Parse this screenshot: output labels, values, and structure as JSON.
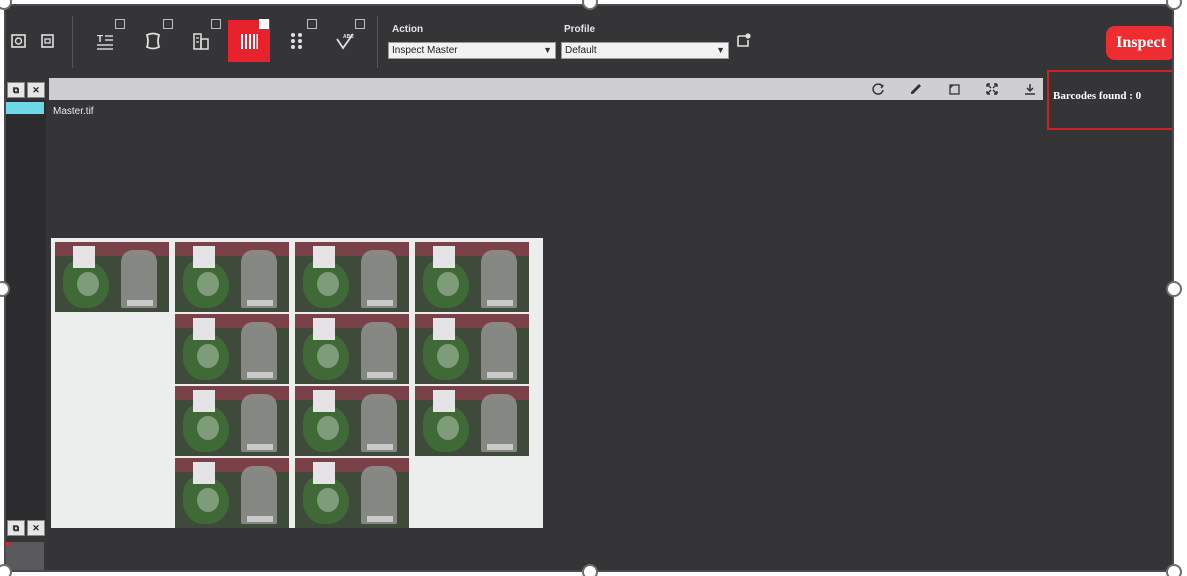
{
  "toolbar": {
    "action_label": "Action",
    "action_value": "Inspect Master",
    "profile_label": "Profile",
    "profile_value": "Default",
    "inspect_label": "Inspect"
  },
  "viewer": {
    "file_name": "Master.tif"
  },
  "results": {
    "barcodes_found": "Barcodes found : 0"
  },
  "mini_panel": {
    "restore_glyph": "⧉",
    "close_glyph": "✕"
  },
  "colors": {
    "accent": "#e8222d",
    "inspect_button": "#ed2d2f",
    "highlight_box": "#d01f25",
    "thumbnail_strip": "#6dd8e6"
  }
}
